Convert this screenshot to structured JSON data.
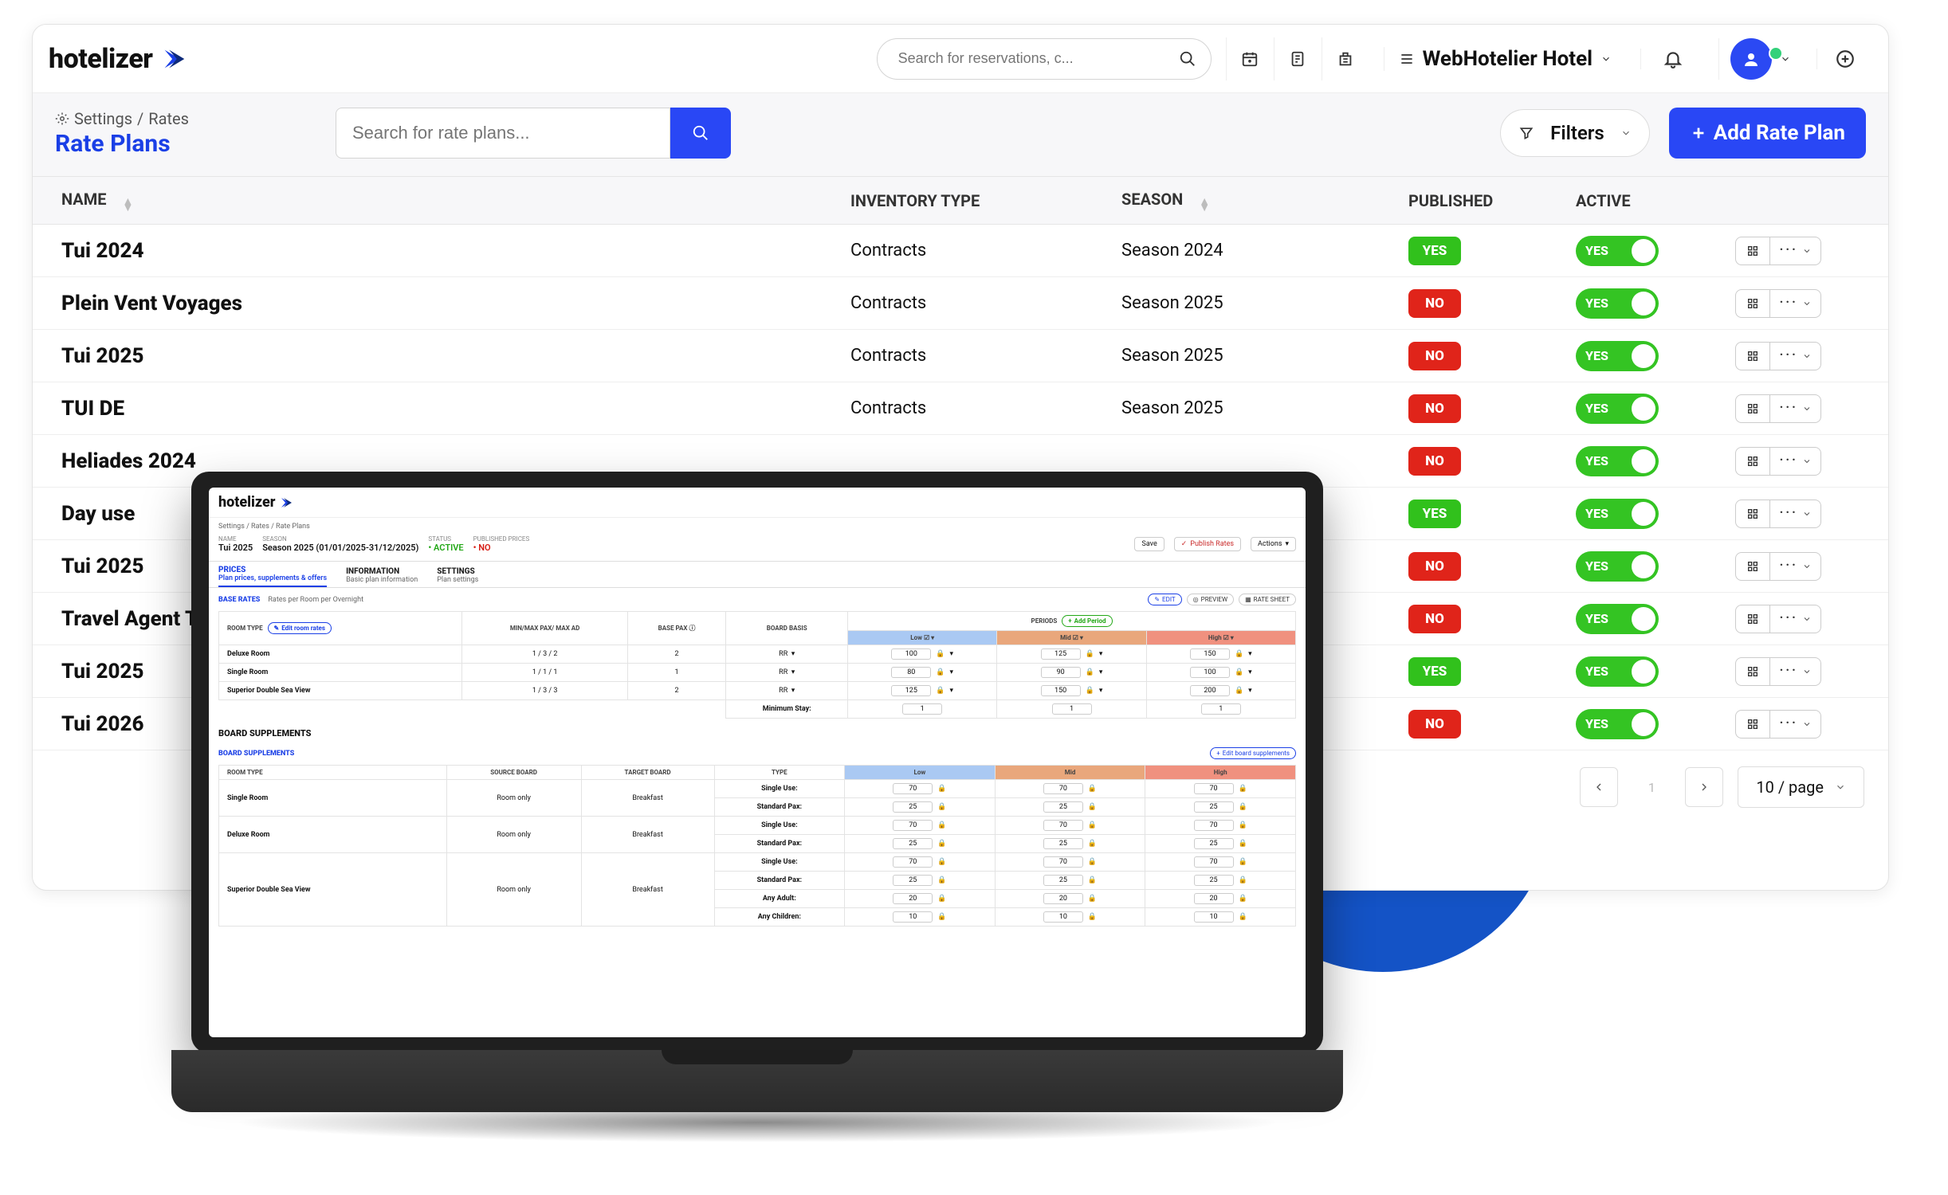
{
  "brand": "hotelizer",
  "header": {
    "search_placeholder": "Search for reservations, c...",
    "hotel_name": "WebHotelier Hotel"
  },
  "subheader": {
    "crumb_1": "Settings",
    "crumb_2": "Rates",
    "title": "Rate Plans",
    "search_placeholder": "Search for rate plans...",
    "filters_label": "Filters",
    "add_label": "Add Rate Plan"
  },
  "columns": {
    "name": "NAME",
    "inventory_type": "INVENTORY TYPE",
    "season": "SEASON",
    "published": "PUBLISHED",
    "active": "ACTIVE"
  },
  "rows": [
    {
      "name": "Tui 2024",
      "inventory": "Contracts",
      "season": "Season 2024",
      "published": "YES",
      "active": "YES"
    },
    {
      "name": "Plein Vent Voyages",
      "inventory": "Contracts",
      "season": "Season 2025",
      "published": "NO",
      "active": "YES"
    },
    {
      "name": "Tui 2025",
      "inventory": "Contracts",
      "season": "Season 2025",
      "published": "NO",
      "active": "YES"
    },
    {
      "name": "TUI DE",
      "inventory": "Contracts",
      "season": "Season 2025",
      "published": "NO",
      "active": "YES"
    },
    {
      "name": "Heliades 2024",
      "inventory": "",
      "season": "",
      "published": "NO",
      "active": "YES"
    },
    {
      "name": "Day use",
      "inventory": "",
      "season": "",
      "published": "YES",
      "active": "YES"
    },
    {
      "name": "Tui 2025",
      "inventory": "",
      "season": "",
      "published": "NO",
      "active": "YES"
    },
    {
      "name": "Travel Agent Test",
      "inventory": "",
      "season": "",
      "published": "NO",
      "active": "YES"
    },
    {
      "name": "Tui 2025",
      "inventory": "",
      "season": "",
      "published": "YES",
      "active": "YES"
    },
    {
      "name": "Tui 2026",
      "inventory": "",
      "season": "",
      "published": "NO",
      "active": "YES"
    }
  ],
  "pagination": {
    "current": "1",
    "per_page": "10 / page"
  },
  "laptop": {
    "crumbs": "Settings / Rates / Rate Plans",
    "name_label": "NAME",
    "name": "Tui 2025",
    "season_label": "SEASON",
    "season": "Season 2025 (01/01/2025-31/12/2025)",
    "status_label": "STATUS",
    "status": "ACTIVE",
    "published_label": "PUBLISHED PRICES",
    "published": "NO",
    "save": "Save",
    "publish": "Publish Rates",
    "actions": "Actions",
    "tabs": {
      "prices_hd": "PRICES",
      "prices_sub": "Plan prices, supplements & offers",
      "info_hd": "INFORMATION",
      "info_sub": "Basic plan information",
      "settings_hd": "SETTINGS",
      "settings_sub": "Plan settings"
    },
    "base_rates_label": "BASE RATES",
    "base_rates_sub": "Rates per Room per Overnight",
    "edit": "EDIT",
    "preview": "PREVIEW",
    "rate_sheet": "RATE SHEET",
    "room_type": "ROOM TYPE",
    "edit_room_rates": "Edit room rates",
    "min_max": "MIN/MAX PAX/ MAX AD",
    "base_pax": "BASE PAX",
    "board_basis": "BOARD BASIS",
    "periods_label": "PERIODS",
    "add_period": "Add Period",
    "periods": {
      "low": "Low",
      "mid": "Mid",
      "high": "High"
    },
    "base_rows": [
      {
        "room": "Deluxe Room",
        "minmax": "1 / 3 / 2",
        "base": "2",
        "bb": "RR",
        "low": "100",
        "mid": "125",
        "high": "150"
      },
      {
        "room": "Single Room",
        "minmax": "1 / 1 / 1",
        "base": "1",
        "bb": "RR",
        "low": "80",
        "mid": "90",
        "high": "100"
      },
      {
        "room": "Superior Double Sea View",
        "minmax": "1 / 3 / 3",
        "base": "2",
        "bb": "RR",
        "low": "125",
        "mid": "150",
        "high": "200"
      }
    ],
    "minstay_label": "Minimum Stay:",
    "minstay": {
      "low": "1",
      "mid": "1",
      "high": "1"
    },
    "board_supplements_label": "BOARD SUPPLEMENTS",
    "edit_board_supp": "Edit board supplements",
    "source_board": "SOURCE BOARD",
    "target_board": "TARGET BOARD",
    "type_label": "TYPE",
    "labels": {
      "single_use": "Single Use:",
      "standard_pax": "Standard Pax:",
      "any_adult": "Any Adult:",
      "any_children": "Any Children:"
    },
    "supp_rows": [
      {
        "room": "Single Room",
        "source": "Room only",
        "target": "Breakfast",
        "lines": [
          {
            "label": "single_use",
            "low": "70",
            "mid": "70",
            "high": "70"
          },
          {
            "label": "standard_pax",
            "low": "25",
            "mid": "25",
            "high": "25"
          }
        ]
      },
      {
        "room": "Deluxe Room",
        "source": "Room only",
        "target": "Breakfast",
        "lines": [
          {
            "label": "single_use",
            "low": "70",
            "mid": "70",
            "high": "70"
          },
          {
            "label": "standard_pax",
            "low": "25",
            "mid": "25",
            "high": "25"
          }
        ]
      },
      {
        "room": "Superior Double Sea View",
        "source": "Room only",
        "target": "Breakfast",
        "lines": [
          {
            "label": "single_use",
            "low": "70",
            "mid": "70",
            "high": "70"
          },
          {
            "label": "standard_pax",
            "low": "25",
            "mid": "25",
            "high": "25"
          },
          {
            "label": "any_adult",
            "low": "20",
            "mid": "20",
            "high": "20"
          },
          {
            "label": "any_children",
            "low": "10",
            "mid": "10",
            "high": "10"
          }
        ]
      }
    ]
  }
}
